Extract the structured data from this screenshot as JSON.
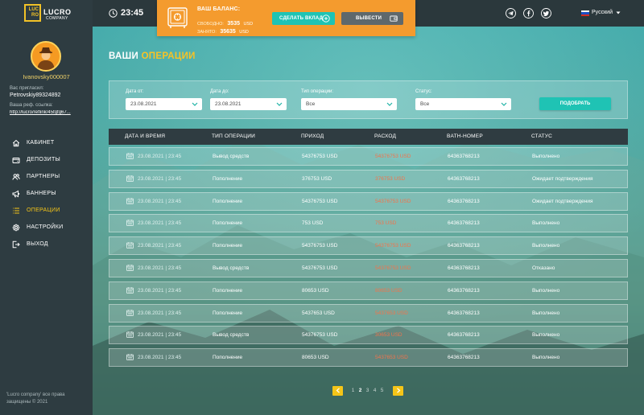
{
  "brand": {
    "mark_top": "LUC",
    "mark_bottom": "RO",
    "name": "LUCRO",
    "subtitle": "COMPANY"
  },
  "header": {
    "time": "23:45",
    "language": "Русский",
    "social_icons": [
      "telegram-icon",
      "facebook-icon",
      "twitter-icon"
    ]
  },
  "balance": {
    "title": "ВАШ БАЛАНС:",
    "free_label": "СВОБОДНО:",
    "free_amount": "3535",
    "free_currency": "USD",
    "busy_label": "ЗАНЯТО:",
    "busy_amount": "35635",
    "busy_currency": "USD",
    "deposit_label": "СДЕЛАТЬ ВКЛАД",
    "withdraw_label": "ВЫВЕСТИ"
  },
  "sidebar": {
    "username": "Ivanovsky000007",
    "invited_label": "Вас пригласил:",
    "invited_by": "Petrovskiy89324892",
    "ref_label": "Ваша реф. ссылка:",
    "ref_link": "http://lucro/reflink/45fgfg67...",
    "menu": [
      {
        "label": "КАБИНЕТ",
        "icon": "home-icon",
        "active": false
      },
      {
        "label": "ДЕПОЗИТЫ",
        "icon": "wallet-icon",
        "active": false
      },
      {
        "label": "ПАРТНЕРЫ",
        "icon": "users-icon",
        "active": false
      },
      {
        "label": "БАННЕРЫ",
        "icon": "megaphone-icon",
        "active": false
      },
      {
        "label": "ОПЕРАЦИИ",
        "icon": "list-icon",
        "active": true
      },
      {
        "label": "НАСТРОЙКИ",
        "icon": "gear-icon",
        "active": false
      },
      {
        "label": "ВЫХОД",
        "icon": "logout-icon",
        "active": false
      }
    ],
    "footer_line1": "'Lucro company' все права",
    "footer_line2": "защищены © 2021"
  },
  "page": {
    "title_part1": "ВАШИ",
    "title_part2": "ОПЕРАЦИИ"
  },
  "filters": {
    "date_from_label": "Дата от:",
    "date_from_value": "23.08.2021",
    "date_to_label": "Дата до:",
    "date_to_value": "23.08.2021",
    "type_label": "Тип операции:",
    "type_value": "Все",
    "status_label": "Статус:",
    "status_value": "Все",
    "submit_label": "ПОДОБРАТЬ"
  },
  "table": {
    "columns": [
      "ДАТА И ВРЕМЯ",
      "ТИП ОПЕРАЦИИ",
      "ПРИХОД",
      "РАСХОД",
      "BATH-НОМЕР",
      "СТАТУС"
    ],
    "rows": [
      {
        "date": "23.08.2021 | 23:45",
        "type": "Вывод средств",
        "income": "54376753 USD",
        "expense": "54376753 USD",
        "batch": "64363768213",
        "status": "Выполнено"
      },
      {
        "date": "23.08.2021 | 23:45",
        "type": "Пополнение",
        "income": "376753 USD",
        "expense": "376753 USD",
        "batch": "64363768213",
        "status": "Ожидает подтверждения"
      },
      {
        "date": "23.08.2021 | 23:45",
        "type": "Пополнение",
        "income": "54376753 USD",
        "expense": "54376753 USD",
        "batch": "64363768213",
        "status": "Ожидает подтверждения"
      },
      {
        "date": "23.08.2021 | 23:45",
        "type": "Пополнение",
        "income": "753 USD",
        "expense": "753 USD",
        "batch": "64363768213",
        "status": "Выполнено"
      },
      {
        "date": "23.08.2021 | 23:45",
        "type": "Пополнение",
        "income": "54376753 USD",
        "expense": "54376753 USD",
        "batch": "64363768213",
        "status": "Выполнено"
      },
      {
        "date": "23.08.2021 | 23:45",
        "type": "Вывод средств",
        "income": "54376753 USD",
        "expense": "54376753 USD",
        "batch": "64363768213",
        "status": "Отказано"
      },
      {
        "date": "23.08.2021 | 23:45",
        "type": "Пополнение",
        "income": "80653 USD",
        "expense": "80653 USD",
        "batch": "64363768213",
        "status": "Выполнено"
      },
      {
        "date": "23.08.2021 | 23:45",
        "type": "Пополнение",
        "income": "5437653 USD",
        "expense": "5437653 USD",
        "batch": "64363768213",
        "status": "Выполнено"
      },
      {
        "date": "23.08.2021 | 23:45",
        "type": "Вывод средств",
        "income": "54376753 USD",
        "expense": "30653 USD",
        "batch": "64363768213",
        "status": "Выполнено"
      },
      {
        "date": "23.08.2021 | 23:45",
        "type": "Пополнение",
        "income": "80653 USD",
        "expense": "5437653 USD",
        "batch": "64363768213",
        "status": "Выполнено"
      }
    ]
  },
  "pagination": {
    "pages": [
      "1",
      "2",
      "3",
      "4",
      "5"
    ],
    "current": "2"
  },
  "colors": {
    "accent_yellow": "#f5c518",
    "balance_orange": "#f49b2e",
    "button_teal": "#1fc3b4",
    "button_gray": "#5e686c",
    "expense_red": "#f2734b",
    "sidebar_bg": "#2e3c41"
  }
}
